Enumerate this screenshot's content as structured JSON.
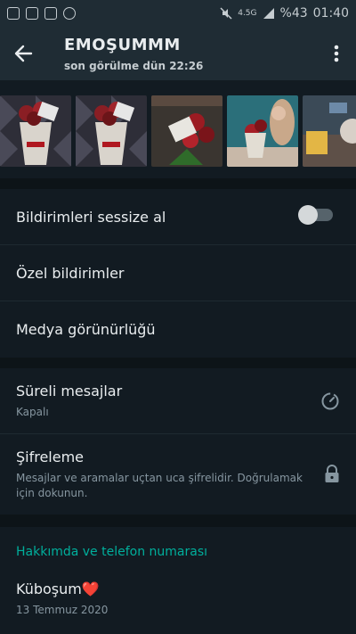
{
  "status_bar": {
    "network": "4.5G",
    "battery": "%43",
    "time": "01:40"
  },
  "header": {
    "title": "EMOŞUMMM",
    "subtitle": "son görülme dün 22:26"
  },
  "media": {
    "thumbs": [
      "thumb-1",
      "thumb-2",
      "thumb-3",
      "thumb-4",
      "thumb-5"
    ]
  },
  "notifications": {
    "mute_label": "Bildirimleri sessize al",
    "mute_on": false,
    "custom_label": "Özel bildirimler",
    "media_visibility_label": "Medya görünürlüğü"
  },
  "security": {
    "disappearing_label": "Süreli mesajlar",
    "disappearing_value": "Kapalı",
    "encryption_label": "Şifreleme",
    "encryption_desc": "Mesajlar ve aramalar uçtan uca şifrelidir. Doğrulamak için dokunun."
  },
  "about": {
    "header": "Hakkımda ve telefon numarası",
    "status_text": "Küboşum❤️",
    "date": "13 Temmuz 2020"
  },
  "colors": {
    "accent": "#00af9c",
    "background": "#0d1418",
    "panel": "#121b22",
    "bar": "#1f2c34"
  }
}
